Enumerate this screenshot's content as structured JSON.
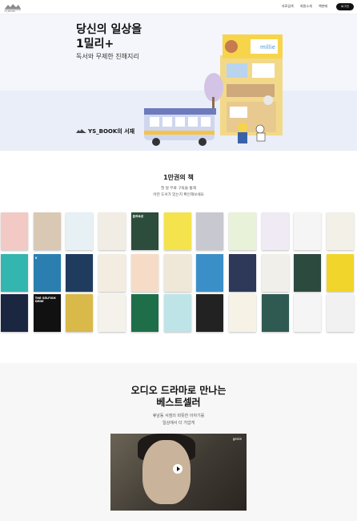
{
  "nav": {
    "logo_text": "YS_BOOK",
    "menu": [
      "자료검색",
      "회원소개",
      "책판매"
    ],
    "login_label": "로그인"
  },
  "hero": {
    "title_line1": "당신의 일상을",
    "title_line2": "1밀리+",
    "subtitle": "독서와 무제한 친해지리",
    "brand": "YS_BOOK의 서재",
    "sign_text": "millie"
  },
  "books_section": {
    "title": "1만권의 책",
    "subtitle_line1": "첫 달 무료 구독을 통해",
    "subtitle_line2": "어떤 도서가 있는지 확인해보세요",
    "rows": [
      [
        {
          "title": "",
          "color": "#f3c9c6"
        },
        {
          "title": "",
          "color": "#d9c9b4"
        },
        {
          "title": "",
          "color": "#e7f0f4"
        },
        {
          "title": "",
          "color": "#f1ede4"
        },
        {
          "title": "돈의속성",
          "color": "#2c4d3b"
        },
        {
          "title": "",
          "color": "#f4e34d"
        },
        {
          "title": "",
          "color": "#c8c8d0"
        },
        {
          "title": "",
          "color": "#e8f2d8"
        },
        {
          "title": "",
          "color": "#efeaf3"
        },
        {
          "title": "",
          "color": "#f5f5f5"
        },
        {
          "title": "",
          "color": "#f3f0e8"
        }
      ],
      [
        {
          "title": "",
          "color": "#33b6b0"
        },
        {
          "title": "X",
          "color": "#2a7fb0"
        },
        {
          "title": "",
          "color": "#1f3c5e"
        },
        {
          "title": "",
          "color": "#f3ece1"
        },
        {
          "title": "",
          "color": "#f6dcc6"
        },
        {
          "title": "",
          "color": "#efe8d9"
        },
        {
          "title": "",
          "color": "#3a8fc9"
        },
        {
          "title": "",
          "color": "#2e3858"
        },
        {
          "title": "",
          "color": "#f0efe9"
        },
        {
          "title": "",
          "color": "#2d4a3f"
        },
        {
          "title": "",
          "color": "#f2d52b"
        },
        {
          "title": "",
          "color": "#111111"
        }
      ],
      [
        {
          "title": "",
          "color": "#1b2640"
        },
        {
          "title": "THE SELFISH GENE",
          "color": "#111111"
        },
        {
          "title": "",
          "color": "#d8b949"
        },
        {
          "title": "",
          "color": "#f4f2ea"
        },
        {
          "title": "",
          "color": "#1e6e4a"
        },
        {
          "title": "",
          "color": "#bfe4e8"
        },
        {
          "title": "",
          "color": "#222222"
        },
        {
          "title": "",
          "color": "#f6f2e6"
        },
        {
          "title": "",
          "color": "#2f5a52"
        },
        {
          "title": "",
          "color": "#f5f5f5"
        },
        {
          "title": "",
          "color": "#f1f1f1"
        }
      ]
    ]
  },
  "audio_section": {
    "title_line1": "오디오 드라마로 만나는",
    "title_line2": "베스트셀러",
    "subtitle_line1": "휴남동 서점의 따뜻한 이야기를",
    "subtitle_line2": "일상에서 더 가깝게",
    "video_badge": "genie"
  }
}
